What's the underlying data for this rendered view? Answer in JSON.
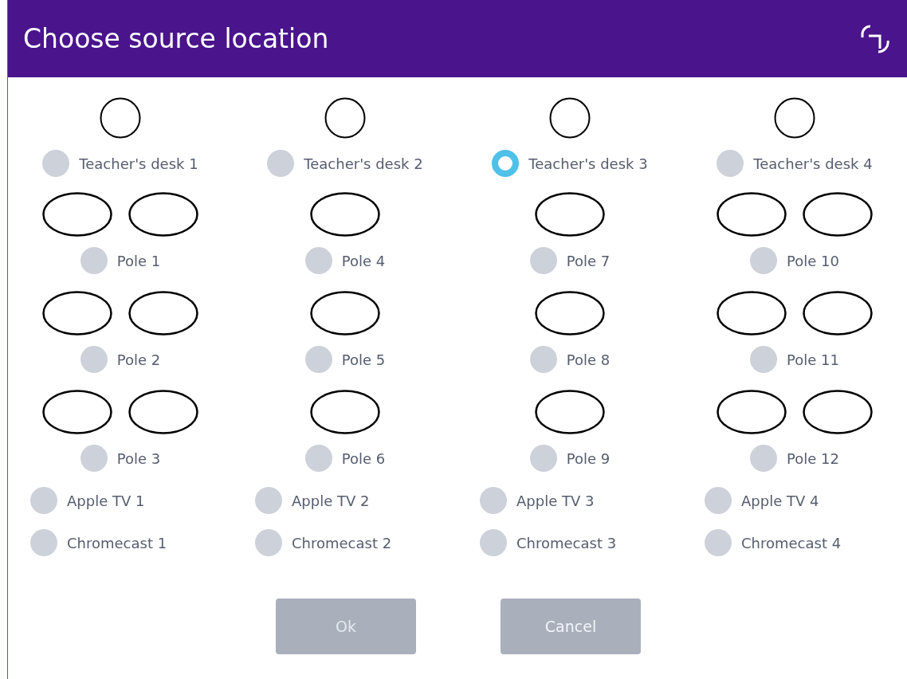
{
  "window": {
    "title": "Choose source location"
  },
  "columns": [
    {
      "desk": {
        "label": "Teacher's desk 1",
        "selected": false
      },
      "poles": [
        {
          "label": "Pole 1",
          "kind": "double",
          "selected": false
        },
        {
          "label": "Pole 2",
          "kind": "double",
          "selected": false
        },
        {
          "label": "Pole 3",
          "kind": "double",
          "selected": false
        }
      ],
      "devices": [
        {
          "label": "Apple TV 1",
          "selected": false
        },
        {
          "label": "Chromecast 1",
          "selected": false
        }
      ]
    },
    {
      "desk": {
        "label": "Teacher's desk 2",
        "selected": false
      },
      "poles": [
        {
          "label": "Pole 4",
          "kind": "single",
          "selected": false
        },
        {
          "label": "Pole 5",
          "kind": "single",
          "selected": false
        },
        {
          "label": "Pole 6",
          "kind": "single",
          "selected": false
        }
      ],
      "devices": [
        {
          "label": "Apple TV 2",
          "selected": false
        },
        {
          "label": "Chromecast 2",
          "selected": false
        }
      ]
    },
    {
      "desk": {
        "label": "Teacher's desk 3",
        "selected": true
      },
      "poles": [
        {
          "label": "Pole 7",
          "kind": "single",
          "selected": false
        },
        {
          "label": "Pole 8",
          "kind": "single",
          "selected": false
        },
        {
          "label": "Pole 9",
          "kind": "single",
          "selected": false
        }
      ],
      "devices": [
        {
          "label": "Apple TV 3",
          "selected": false
        },
        {
          "label": "Chromecast 3",
          "selected": false
        }
      ]
    },
    {
      "desk": {
        "label": "Teacher's desk 4",
        "selected": false
      },
      "poles": [
        {
          "label": "Pole 10",
          "kind": "double",
          "selected": false
        },
        {
          "label": "Pole 11",
          "kind": "double",
          "selected": false
        },
        {
          "label": "Pole 12",
          "kind": "double",
          "selected": false
        }
      ],
      "devices": [
        {
          "label": "Apple TV 4",
          "selected": false
        },
        {
          "label": "Chromecast 4",
          "selected": false
        }
      ]
    }
  ],
  "buttons": [
    {
      "label": "Ok",
      "disabled": true
    },
    {
      "label": "Cancel",
      "disabled": false
    }
  ]
}
